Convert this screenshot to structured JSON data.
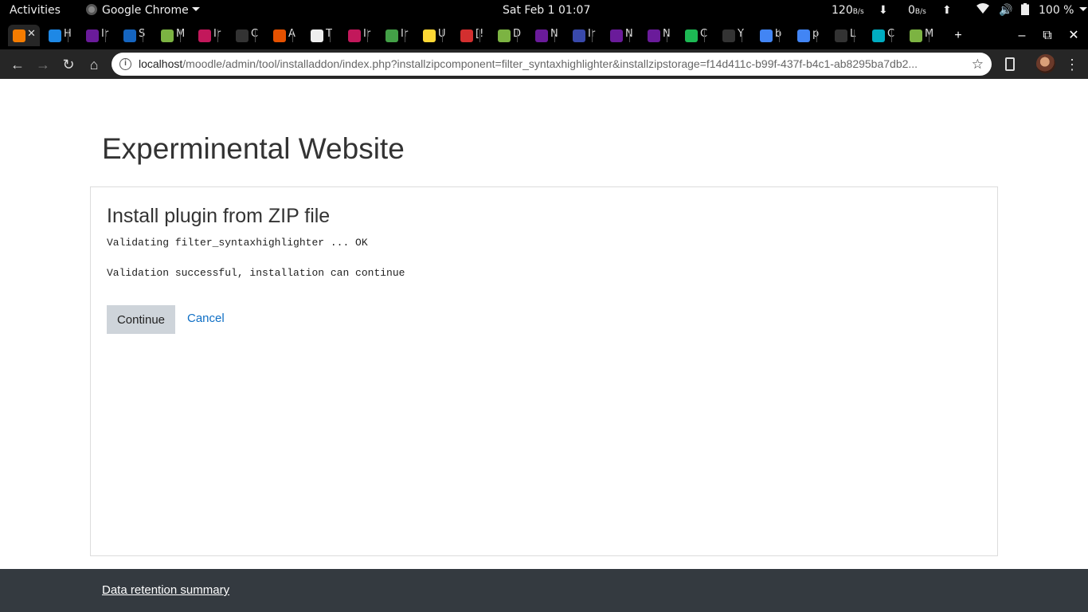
{
  "system_bar": {
    "activities": "Activities",
    "app_name": "Google Chrome",
    "clock": "Sat Feb 1  01:07",
    "net_down": "120",
    "net_down_unit": "B/s",
    "net_up": "0",
    "net_up_unit": "B/s",
    "battery": "100 %"
  },
  "tabs": [
    {
      "letter": "",
      "color": "#f57c00",
      "active": true
    },
    {
      "letter": "H",
      "color": "#1e88e5"
    },
    {
      "letter": "Ir",
      "color": "#6a1b9a"
    },
    {
      "letter": "S",
      "color": "#1565c0"
    },
    {
      "letter": "M",
      "color": "#7cb342"
    },
    {
      "letter": "Ir",
      "color": "#c2185b"
    },
    {
      "letter": "C",
      "color": "#333333"
    },
    {
      "letter": "A",
      "color": "#e65100"
    },
    {
      "letter": "T",
      "color": "#eeeeee"
    },
    {
      "letter": "Ir",
      "color": "#c2185b"
    },
    {
      "letter": "Ir",
      "color": "#43a047"
    },
    {
      "letter": "U",
      "color": "#fdd835"
    },
    {
      "letter": "[!",
      "color": "#d32f2f"
    },
    {
      "letter": "D",
      "color": "#7cb342"
    },
    {
      "letter": "N",
      "color": "#6a1b9a"
    },
    {
      "letter": "Ir",
      "color": "#3949ab"
    },
    {
      "letter": "N",
      "color": "#6a1b9a"
    },
    {
      "letter": "N",
      "color": "#6a1b9a"
    },
    {
      "letter": "C",
      "color": "#1db954"
    },
    {
      "letter": "Y",
      "color": "#333333"
    },
    {
      "letter": "b",
      "color": "#4285f4"
    },
    {
      "letter": "p",
      "color": "#4285f4"
    },
    {
      "letter": "L",
      "color": "#333333"
    },
    {
      "letter": "C",
      "color": "#00acc1"
    },
    {
      "letter": "M",
      "color": "#7cb342"
    }
  ],
  "window_controls": {
    "new_tab": "+",
    "minimize": "–",
    "restore": "⧉",
    "close": "✕"
  },
  "toolbar": {
    "url_host": "localhost",
    "url_path": "/moodle/admin/tool/installaddon/index.php?installzipcomponent=filter_syntaxhighlighter&installzipstorage=f14d411c-b99f-437f-b4c1-ab8295ba7db2..."
  },
  "page": {
    "site_title": "Experminental Website",
    "heading": "Install plugin from ZIP file",
    "validation_line": "Validating filter_syntaxhighlighter ... OK",
    "result_line": "Validation successful, installation can continue",
    "continue_label": "Continue",
    "cancel_label": "Cancel"
  },
  "footer": {
    "link_label": "Data retention summary"
  }
}
